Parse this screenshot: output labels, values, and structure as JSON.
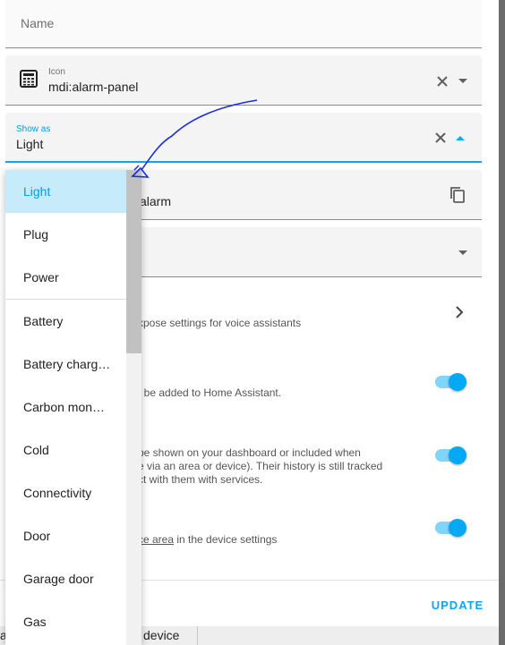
{
  "dialog": {
    "name_field": {
      "placeholder": "Name"
    },
    "icon_field": {
      "label": "Icon",
      "value": "mdi:alarm-panel"
    },
    "show_as_field": {
      "label": "Show as",
      "value": "Light"
    },
    "entity_id_field": {
      "partial_value": "alarm"
    },
    "voice_row": {
      "partial_text": "xpose settings for voice assistants"
    },
    "enabled_row": {
      "partial_text": "t be added to Home Assistant.",
      "toggle_on": true
    },
    "visible_row": {
      "line1": "be shown on your dashboard or included when",
      "line2": "e via an area or device). Their history is still tracked",
      "line3": "ct with them with services.",
      "toggle_on": true
    },
    "area_row": {
      "link_text": "ce area",
      "rest_text": " in the device settings",
      "toggle_on": true
    },
    "update_button": "UPDATE"
  },
  "dropdown": {
    "options": [
      {
        "label": "Light",
        "selected": true
      },
      {
        "label": "Plug"
      },
      {
        "label": "Power"
      },
      {
        "label": "Battery"
      },
      {
        "label": "Battery charg…"
      },
      {
        "label": "Carbon mon…"
      },
      {
        "label": "Cold"
      },
      {
        "label": "Connectivity"
      },
      {
        "label": "Door"
      },
      {
        "label": "Garage door"
      },
      {
        "label": "Gas"
      }
    ]
  },
  "background": {
    "partial_left": "a",
    "partial_device": "device"
  },
  "colors": {
    "accent": "#03a9f4",
    "selected_bg": "#c6ecfb",
    "annotation": "#1b2fd6"
  }
}
